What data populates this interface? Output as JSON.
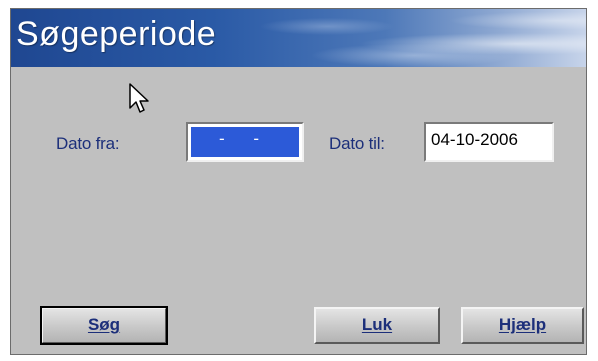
{
  "window": {
    "title": "Søgeperiode"
  },
  "form": {
    "from_label": "Dato fra:",
    "from_value": "  -  -  ",
    "to_label": "Dato til:",
    "to_value": "04-10-2006"
  },
  "buttons": {
    "search": "Søg",
    "close": "Luk",
    "help": "Hjælp"
  },
  "colors": {
    "title_gradient_start": "#1f4791",
    "dialog_background": "#c0c0c0",
    "label_text": "#1c2f7a",
    "selection": "#2c5ad8"
  },
  "icons": {
    "cursor": "mouse-pointer-icon"
  }
}
